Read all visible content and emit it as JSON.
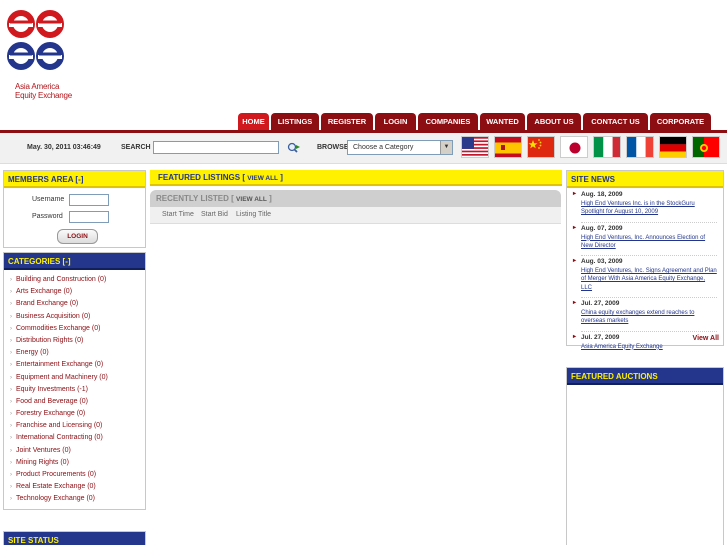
{
  "brand": {
    "logo_line1": "Asia America",
    "logo_line2": "Equity Exchange",
    "colors": {
      "red": "#d0191f",
      "dark_red": "#8c0d12",
      "navy": "#23368c",
      "yellow": "#fff100"
    }
  },
  "nav": {
    "tabs": [
      {
        "label": "HOME",
        "active": true
      },
      {
        "label": "LISTINGS"
      },
      {
        "label": "REGISTER"
      },
      {
        "label": "LOGIN"
      },
      {
        "label": "COMPANIES"
      },
      {
        "label": "WANTED"
      },
      {
        "label": "ABOUT US"
      },
      {
        "label": "CONTACT US"
      },
      {
        "label": "CORPORATE"
      }
    ]
  },
  "toolbar": {
    "datetime": "May. 30, 2011 03:46:49",
    "search_label": "SEARCH",
    "search_value": "",
    "search_icon": "magnifier-go-icon",
    "browse_label": "BROWSE",
    "browse_selected": "Choose a Category",
    "flags": [
      "usa-flag",
      "spain-flag",
      "china-flag",
      "japan-flag",
      "italy-flag",
      "france-flag",
      "germany-flag",
      "portugal-flag"
    ]
  },
  "members": {
    "title": "MEMBERS AREA [-]",
    "username_label": "Username",
    "password_label": "Password",
    "login_label": "LOGIN"
  },
  "categories": {
    "title": "CATEGORIES [-]",
    "items": [
      "Building and Construction (0)",
      "Arts Exchange (0)",
      "Brand Exchange (0)",
      "Business Acquisition (0)",
      "Commodities Exchange (0)",
      "Distribution Rights (0)",
      "Energy (0)",
      "Entertainment Exchange (0)",
      "Equipment and Machinery (0)",
      "Equity Investments (-1)",
      "Food and Beverage (0)",
      "Forestry Exchange (0)",
      "Franchise and Licensing (0)",
      "International Contracting (0)",
      "Joint Ventures (0)",
      "Mining Rights (0)",
      "Product Procurements (0)",
      "Real Estate Exchange (0)",
      "Technology Exchange (0)"
    ]
  },
  "site_status": {
    "title": "SITE STATUS"
  },
  "featured": {
    "title": "FEATURED LISTINGS",
    "view_all": "VIEW ALL"
  },
  "recently_listed": {
    "title": "RECENTLY LISTED",
    "view_all": "VIEW ALL",
    "columns": [
      "Start Time",
      "Start Bid",
      "Listing Title"
    ]
  },
  "news": {
    "title": "SITE NEWS",
    "items": [
      {
        "date": "Aug. 18, 2009",
        "link_a": "High End Ventures Inc. is in the StockGuru",
        "link_b": "Spotlight for August 10, 2009"
      },
      {
        "date": "Aug. 07, 2009",
        "link_a": "High End Ventures, Inc. Announces Election of",
        "link_b": "New Director"
      },
      {
        "date": "Aug. 03, 2009",
        "link_a": "High End Ventures, Inc. Signs Agreement and Plan",
        "link_b": "of Merger With Asia America Equity Exchange, LLC"
      },
      {
        "date": "Jul. 27, 2009",
        "link_a": "China equity exchanges extend reaches to",
        "link_b": "overseas markets"
      },
      {
        "date": "Jul. 27, 2009",
        "link_a": "Asia America Equity Exchange",
        "link_b": ""
      }
    ],
    "view_all": "View All"
  },
  "auctions": {
    "title": "FEATURED AUCTIONS"
  }
}
